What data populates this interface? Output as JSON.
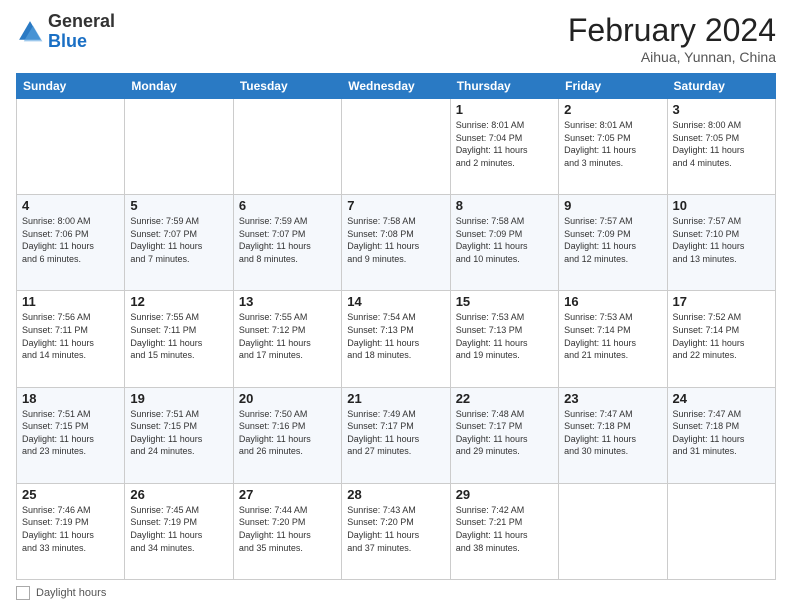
{
  "header": {
    "logo_general": "General",
    "logo_blue": "Blue",
    "month_year": "February 2024",
    "location": "Aihua, Yunnan, China"
  },
  "days_of_week": [
    "Sunday",
    "Monday",
    "Tuesday",
    "Wednesday",
    "Thursday",
    "Friday",
    "Saturday"
  ],
  "weeks": [
    [
      {
        "day": "",
        "info": ""
      },
      {
        "day": "",
        "info": ""
      },
      {
        "day": "",
        "info": ""
      },
      {
        "day": "",
        "info": ""
      },
      {
        "day": "1",
        "info": "Sunrise: 8:01 AM\nSunset: 7:04 PM\nDaylight: 11 hours\nand 2 minutes."
      },
      {
        "day": "2",
        "info": "Sunrise: 8:01 AM\nSunset: 7:05 PM\nDaylight: 11 hours\nand 3 minutes."
      },
      {
        "day": "3",
        "info": "Sunrise: 8:00 AM\nSunset: 7:05 PM\nDaylight: 11 hours\nand 4 minutes."
      }
    ],
    [
      {
        "day": "4",
        "info": "Sunrise: 8:00 AM\nSunset: 7:06 PM\nDaylight: 11 hours\nand 6 minutes."
      },
      {
        "day": "5",
        "info": "Sunrise: 7:59 AM\nSunset: 7:07 PM\nDaylight: 11 hours\nand 7 minutes."
      },
      {
        "day": "6",
        "info": "Sunrise: 7:59 AM\nSunset: 7:07 PM\nDaylight: 11 hours\nand 8 minutes."
      },
      {
        "day": "7",
        "info": "Sunrise: 7:58 AM\nSunset: 7:08 PM\nDaylight: 11 hours\nand 9 minutes."
      },
      {
        "day": "8",
        "info": "Sunrise: 7:58 AM\nSunset: 7:09 PM\nDaylight: 11 hours\nand 10 minutes."
      },
      {
        "day": "9",
        "info": "Sunrise: 7:57 AM\nSunset: 7:09 PM\nDaylight: 11 hours\nand 12 minutes."
      },
      {
        "day": "10",
        "info": "Sunrise: 7:57 AM\nSunset: 7:10 PM\nDaylight: 11 hours\nand 13 minutes."
      }
    ],
    [
      {
        "day": "11",
        "info": "Sunrise: 7:56 AM\nSunset: 7:11 PM\nDaylight: 11 hours\nand 14 minutes."
      },
      {
        "day": "12",
        "info": "Sunrise: 7:55 AM\nSunset: 7:11 PM\nDaylight: 11 hours\nand 15 minutes."
      },
      {
        "day": "13",
        "info": "Sunrise: 7:55 AM\nSunset: 7:12 PM\nDaylight: 11 hours\nand 17 minutes."
      },
      {
        "day": "14",
        "info": "Sunrise: 7:54 AM\nSunset: 7:13 PM\nDaylight: 11 hours\nand 18 minutes."
      },
      {
        "day": "15",
        "info": "Sunrise: 7:53 AM\nSunset: 7:13 PM\nDaylight: 11 hours\nand 19 minutes."
      },
      {
        "day": "16",
        "info": "Sunrise: 7:53 AM\nSunset: 7:14 PM\nDaylight: 11 hours\nand 21 minutes."
      },
      {
        "day": "17",
        "info": "Sunrise: 7:52 AM\nSunset: 7:14 PM\nDaylight: 11 hours\nand 22 minutes."
      }
    ],
    [
      {
        "day": "18",
        "info": "Sunrise: 7:51 AM\nSunset: 7:15 PM\nDaylight: 11 hours\nand 23 minutes."
      },
      {
        "day": "19",
        "info": "Sunrise: 7:51 AM\nSunset: 7:15 PM\nDaylight: 11 hours\nand 24 minutes."
      },
      {
        "day": "20",
        "info": "Sunrise: 7:50 AM\nSunset: 7:16 PM\nDaylight: 11 hours\nand 26 minutes."
      },
      {
        "day": "21",
        "info": "Sunrise: 7:49 AM\nSunset: 7:17 PM\nDaylight: 11 hours\nand 27 minutes."
      },
      {
        "day": "22",
        "info": "Sunrise: 7:48 AM\nSunset: 7:17 PM\nDaylight: 11 hours\nand 29 minutes."
      },
      {
        "day": "23",
        "info": "Sunrise: 7:47 AM\nSunset: 7:18 PM\nDaylight: 11 hours\nand 30 minutes."
      },
      {
        "day": "24",
        "info": "Sunrise: 7:47 AM\nSunset: 7:18 PM\nDaylight: 11 hours\nand 31 minutes."
      }
    ],
    [
      {
        "day": "25",
        "info": "Sunrise: 7:46 AM\nSunset: 7:19 PM\nDaylight: 11 hours\nand 33 minutes."
      },
      {
        "day": "26",
        "info": "Sunrise: 7:45 AM\nSunset: 7:19 PM\nDaylight: 11 hours\nand 34 minutes."
      },
      {
        "day": "27",
        "info": "Sunrise: 7:44 AM\nSunset: 7:20 PM\nDaylight: 11 hours\nand 35 minutes."
      },
      {
        "day": "28",
        "info": "Sunrise: 7:43 AM\nSunset: 7:20 PM\nDaylight: 11 hours\nand 37 minutes."
      },
      {
        "day": "29",
        "info": "Sunrise: 7:42 AM\nSunset: 7:21 PM\nDaylight: 11 hours\nand 38 minutes."
      },
      {
        "day": "",
        "info": ""
      },
      {
        "day": "",
        "info": ""
      }
    ]
  ],
  "footer": {
    "daylight_hours": "Daylight hours"
  }
}
